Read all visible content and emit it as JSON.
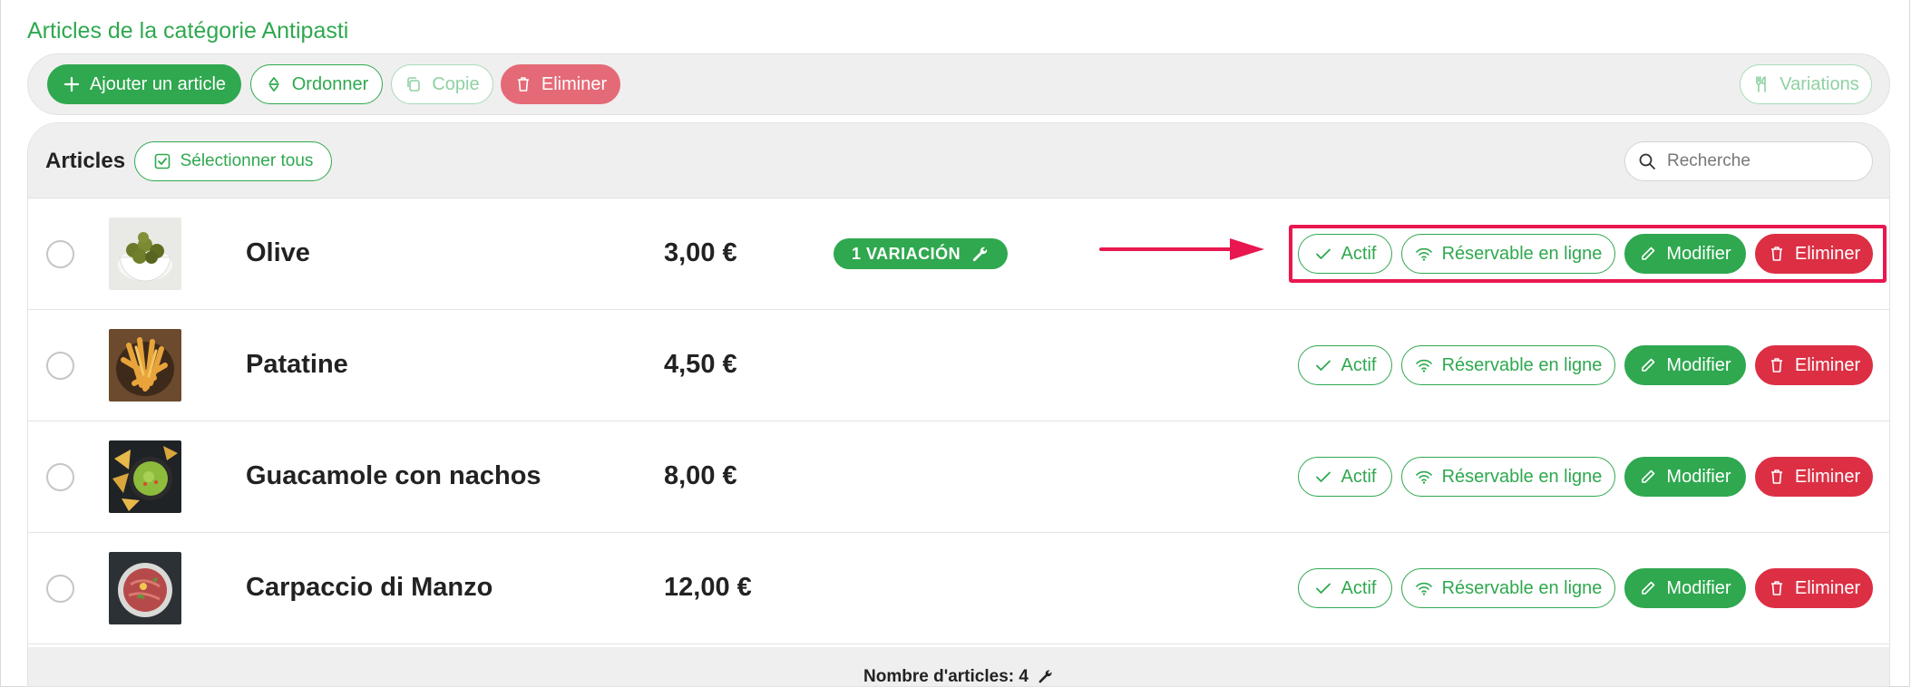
{
  "section_title": "Articles de la catégorie Antipasti",
  "toolbar": {
    "add_label": "Ajouter un article",
    "order_label": "Ordonner",
    "copy_label": "Copie",
    "delete_label": "Eliminer",
    "variations_label": "Variations"
  },
  "articles_header": {
    "title": "Articles",
    "select_all_label": "Sélectionner tous",
    "search_placeholder": "Recherche"
  },
  "row_actions": {
    "actif": "Actif",
    "reservable": "Réservable en ligne",
    "modifier": "Modifier",
    "eliminer": "Eliminer"
  },
  "items": [
    {
      "name": "Olive",
      "price": "3,00 €",
      "badge": "1 VARIACIÓN",
      "image": "olives-photo"
    },
    {
      "name": "Patatine",
      "price": "4,50 €",
      "badge": "",
      "image": "fries-photo"
    },
    {
      "name": "Guacamole con nachos",
      "price": "8,00 €",
      "badge": "",
      "image": "guacamole-photo"
    },
    {
      "name": "Carpaccio di Manzo",
      "price": "12,00 €",
      "badge": "",
      "image": "carpaccio-photo"
    }
  ],
  "footer": {
    "count_label": "Nombre d'articles: 4"
  },
  "colors": {
    "green": "#2fa84f",
    "red": "#dc2f44",
    "highlight": "#e8174f"
  }
}
